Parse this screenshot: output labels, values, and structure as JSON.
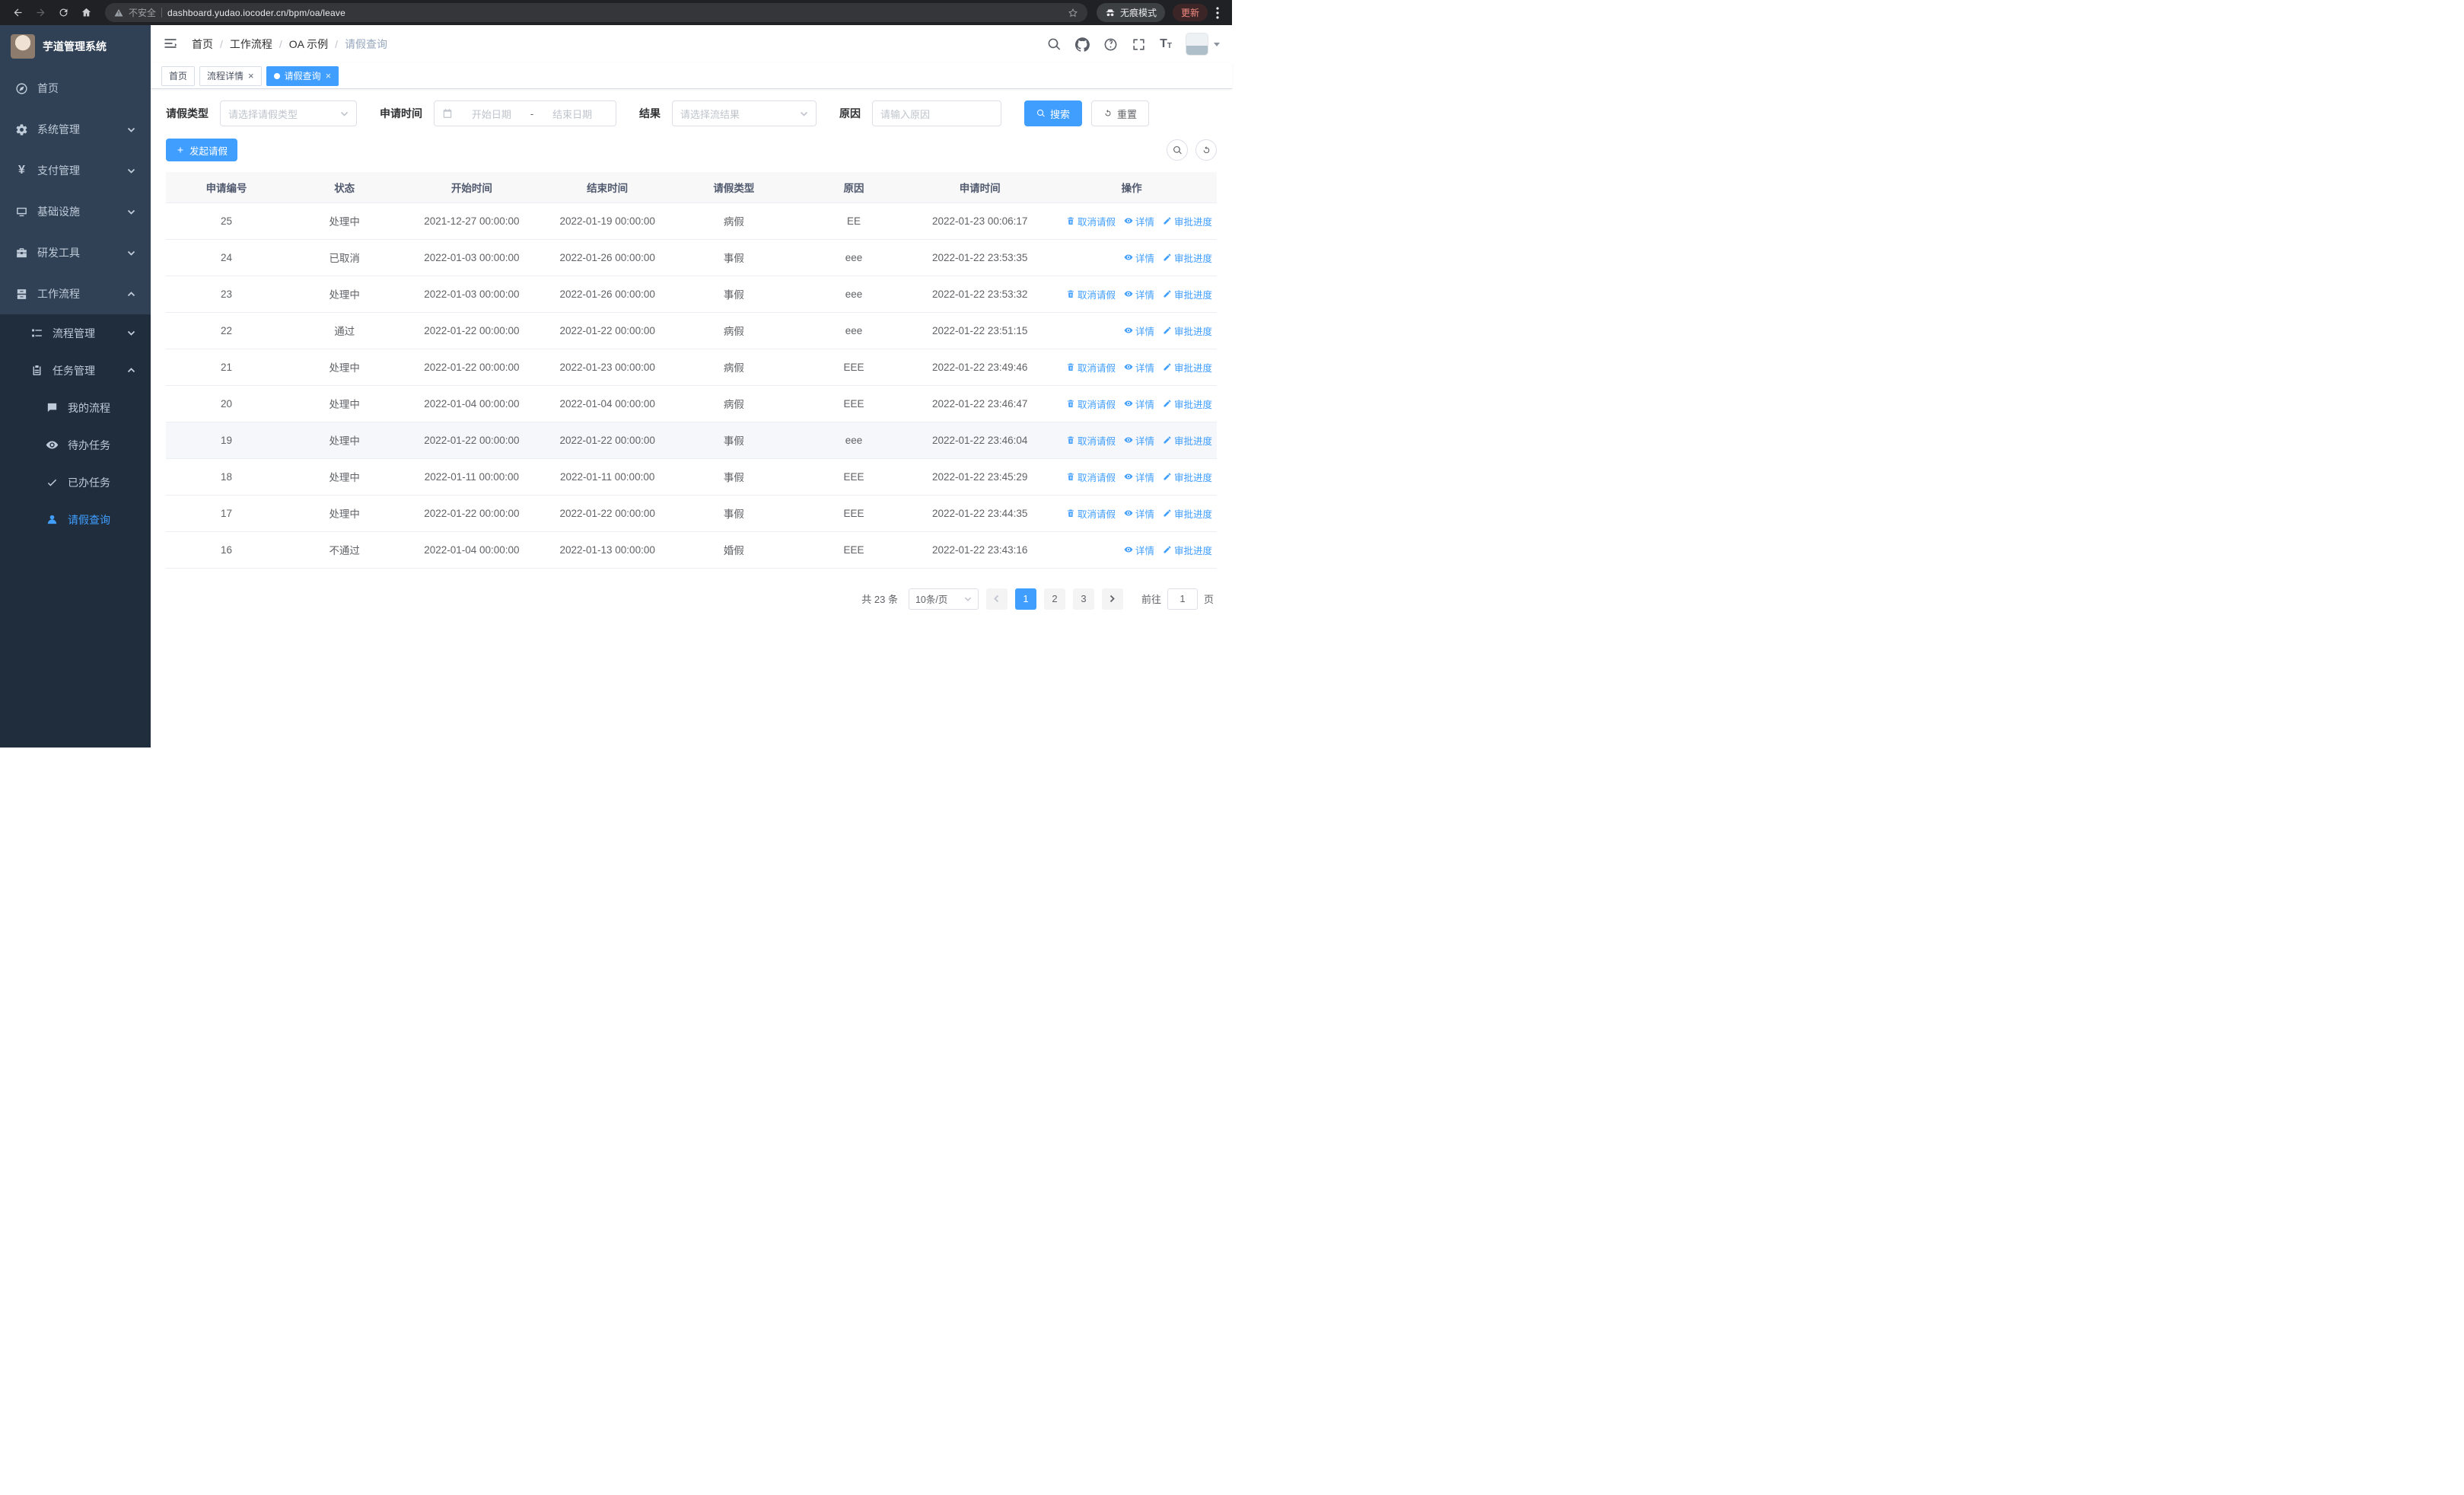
{
  "colors": {
    "accent": "#409eff",
    "sidebar_bg": "#304156",
    "submenu_bg": "#1f2d3d",
    "chrome_bg": "#202124",
    "update_color": "#f28b82"
  },
  "browser": {
    "nav_icons": [
      "back-icon",
      "forward-icon",
      "reload-icon",
      "home-icon"
    ],
    "security_label": "不安全",
    "url": "dashboard.yudao.iocoder.cn/bpm/oa/leave",
    "incognito_label": "无痕模式",
    "update_label": "更新"
  },
  "sidebar": {
    "logo_title": "芋道管理系统",
    "items": [
      {
        "label": "首页",
        "icon": "dashboard-icon",
        "level": 1
      },
      {
        "label": "系统管理",
        "icon": "gear-icon",
        "level": 1,
        "chevron": "down"
      },
      {
        "label": "支付管理",
        "icon": "yen-icon",
        "level": 1,
        "chevron": "down"
      },
      {
        "label": "基础设施",
        "icon": "monitor-icon",
        "level": 1,
        "chevron": "down"
      },
      {
        "label": "研发工具",
        "icon": "toolbox-icon",
        "level": 1,
        "chevron": "down"
      },
      {
        "label": "工作流程",
        "icon": "cabinet-icon",
        "level": 1,
        "chevron": "up",
        "expanded": true
      },
      {
        "label": "流程管理",
        "icon": "list-tree-icon",
        "level": 2,
        "chevron": "down"
      },
      {
        "label": "任务管理",
        "icon": "clipboard-icon",
        "level": 2,
        "chevron": "up",
        "expanded": true
      },
      {
        "label": "我的流程",
        "icon": "message-icon",
        "level": 3
      },
      {
        "label": "待办任务",
        "icon": "eye-icon",
        "level": 3
      },
      {
        "label": "已办任务",
        "icon": "check-icon",
        "level": 3
      },
      {
        "label": "请假查询",
        "icon": "user-icon",
        "level": 3,
        "active": true
      }
    ]
  },
  "topbar": {
    "breadcrumb": {
      "separator": "/",
      "items": [
        "首页",
        "工作流程",
        "OA 示例",
        "请假查询"
      ]
    },
    "icons": [
      "search-icon",
      "github-icon",
      "help-icon",
      "fullscreen-icon",
      "font-size-icon"
    ]
  },
  "tags_bar": {
    "close_glyph": "×",
    "tabs": [
      {
        "label": "首页",
        "closable": false,
        "active": false
      },
      {
        "label": "流程详情",
        "closable": true,
        "active": false
      },
      {
        "label": "请假查询",
        "closable": true,
        "active": true
      }
    ]
  },
  "filters": {
    "leave_type_label": "请假类型",
    "leave_type_placeholder": "请选择请假类型",
    "apply_time_label": "申请时间",
    "start_date_placeholder": "开始日期",
    "range_separator": "-",
    "end_date_placeholder": "结束日期",
    "result_label": "结果",
    "result_placeholder": "请选择流结果",
    "reason_label": "原因",
    "reason_placeholder": "请输入原因",
    "search_button": "搜索",
    "reset_button": "重置"
  },
  "toolbar": {
    "create_button": "发起请假"
  },
  "table": {
    "columns": [
      "申请编号",
      "状态",
      "开始时间",
      "结束时间",
      "请假类型",
      "原因",
      "申请时间",
      "操作"
    ],
    "actions_meta": [
      {
        "key": "cancel",
        "label": "取消请假",
        "icon": "trash-icon"
      },
      {
        "key": "detail",
        "label": "详情",
        "icon": "eye-icon"
      },
      {
        "key": "progress",
        "label": "审批进度",
        "icon": "pen-icon"
      }
    ],
    "rows": [
      {
        "id": "25",
        "status": "处理中",
        "start": "2021-12-27 00:00:00",
        "end": "2022-01-19 00:00:00",
        "type": "病假",
        "reason": "EE",
        "apply_time": "2022-01-23 00:06:17",
        "actions": [
          "cancel",
          "detail",
          "progress"
        ]
      },
      {
        "id": "24",
        "status": "已取消",
        "start": "2022-01-03 00:00:00",
        "end": "2022-01-26 00:00:00",
        "type": "事假",
        "reason": "eee",
        "apply_time": "2022-01-22 23:53:35",
        "actions": [
          "detail",
          "progress"
        ]
      },
      {
        "id": "23",
        "status": "处理中",
        "start": "2022-01-03 00:00:00",
        "end": "2022-01-26 00:00:00",
        "type": "事假",
        "reason": "eee",
        "apply_time": "2022-01-22 23:53:32",
        "actions": [
          "cancel",
          "detail",
          "progress"
        ]
      },
      {
        "id": "22",
        "status": "通过",
        "start": "2022-01-22 00:00:00",
        "end": "2022-01-22 00:00:00",
        "type": "病假",
        "reason": "eee",
        "apply_time": "2022-01-22 23:51:15",
        "actions": [
          "detail",
          "progress"
        ]
      },
      {
        "id": "21",
        "status": "处理中",
        "start": "2022-01-22 00:00:00",
        "end": "2022-01-23 00:00:00",
        "type": "病假",
        "reason": "EEE",
        "apply_time": "2022-01-22 23:49:46",
        "actions": [
          "cancel",
          "detail",
          "progress"
        ]
      },
      {
        "id": "20",
        "status": "处理中",
        "start": "2022-01-04 00:00:00",
        "end": "2022-01-04 00:00:00",
        "type": "病假",
        "reason": "EEE",
        "apply_time": "2022-01-22 23:46:47",
        "actions": [
          "cancel",
          "detail",
          "progress"
        ]
      },
      {
        "id": "19",
        "status": "处理中",
        "start": "2022-01-22 00:00:00",
        "end": "2022-01-22 00:00:00",
        "type": "事假",
        "reason": "eee",
        "apply_time": "2022-01-22 23:46:04",
        "actions": [
          "cancel",
          "detail",
          "progress"
        ],
        "highlighted": true
      },
      {
        "id": "18",
        "status": "处理中",
        "start": "2022-01-11 00:00:00",
        "end": "2022-01-11 00:00:00",
        "type": "事假",
        "reason": "EEE",
        "apply_time": "2022-01-22 23:45:29",
        "actions": [
          "cancel",
          "detail",
          "progress"
        ]
      },
      {
        "id": "17",
        "status": "处理中",
        "start": "2022-01-22 00:00:00",
        "end": "2022-01-22 00:00:00",
        "type": "事假",
        "reason": "EEE",
        "apply_time": "2022-01-22 23:44:35",
        "actions": [
          "cancel",
          "detail",
          "progress"
        ]
      },
      {
        "id": "16",
        "status": "不通过",
        "start": "2022-01-04 00:00:00",
        "end": "2022-01-13 00:00:00",
        "type": "婚假",
        "reason": "EEE",
        "apply_time": "2022-01-22 23:43:16",
        "actions": [
          "detail",
          "progress"
        ]
      }
    ]
  },
  "pagination": {
    "total": "共 23 条",
    "page_size": "10条/页",
    "pages": [
      {
        "label": "1",
        "active": true
      },
      {
        "label": "2",
        "active": false
      },
      {
        "label": "3",
        "active": false
      }
    ],
    "goto_label": "前往",
    "goto_value": "1",
    "goto_unit": "页"
  }
}
